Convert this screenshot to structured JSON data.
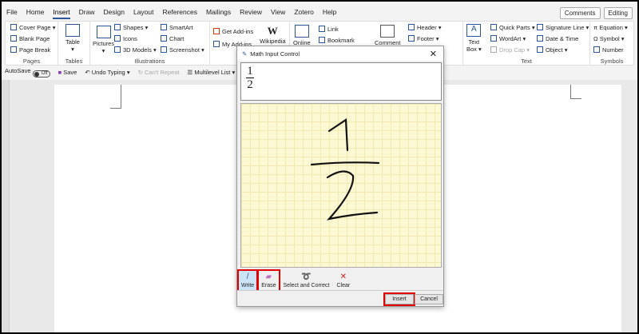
{
  "tabs": [
    "File",
    "Home",
    "Insert",
    "Draw",
    "Design",
    "Layout",
    "References",
    "Mailings",
    "Review",
    "View",
    "Zotero",
    "Help"
  ],
  "active_tab": "Insert",
  "top_buttons": {
    "comments": "Comments",
    "editing": "Editing"
  },
  "ribbon": {
    "pages": {
      "items": [
        "Cover Page",
        "Blank Page",
        "Page Break"
      ],
      "label": "Pages"
    },
    "tables": {
      "table": "Table",
      "label": "Tables"
    },
    "illustrations": {
      "pictures": "Pictures",
      "items": [
        "Shapes",
        "Icons",
        "3D Models",
        "SmartArt",
        "Chart",
        "Screenshot"
      ],
      "label": "Illustrations"
    },
    "addins": {
      "items": [
        "Get Add-ins",
        "My Add-ins"
      ],
      "wikipedia": "Wikipedia"
    },
    "media": {
      "online": "Online"
    },
    "links": {
      "items": [
        "Link",
        "Bookmark"
      ]
    },
    "comments": {
      "comment": "Comment"
    },
    "header_footer": {
      "items": [
        "Header",
        "Footer"
      ]
    },
    "text": {
      "textbox1": "Text",
      "textbox2": "Box",
      "items": [
        "Quick Parts",
        "WordArt",
        "Drop Cap",
        "Signature Line",
        "Date & Time",
        "Object"
      ],
      "label": "Text"
    },
    "symbols": {
      "items": [
        "Equation",
        "Symbol",
        "Number"
      ],
      "label": "Symbols"
    }
  },
  "qat": {
    "autosave": "AutoSave",
    "autosave_state": "Off",
    "save": "Save",
    "undo": "Undo Typing",
    "repeat": "Can't Repeat",
    "multilevel": "Multilevel List"
  },
  "dialog": {
    "title": "Math Input Control",
    "preview_num": "1",
    "preview_den": "2",
    "tools": [
      "Write",
      "Erase",
      "Select and Correct",
      "Clear"
    ],
    "insert": "Insert",
    "cancel": "Cancel"
  }
}
